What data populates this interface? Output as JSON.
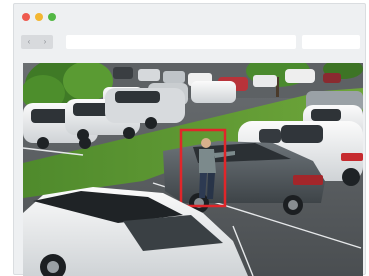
{
  "window": {
    "controls": [
      "close",
      "minimize",
      "zoom"
    ],
    "nav": {
      "back_icon": "chevron-left-icon",
      "forward_icon": "chevron-right-icon",
      "back_glyph": "‹",
      "forward_glyph": "›"
    },
    "address_value": "",
    "search_value": ""
  },
  "colors": {
    "frame": "#eef0f2",
    "close": "#ee5a4f",
    "minimize": "#f3b632",
    "zoom": "#52b744",
    "highlight_box": "#e0262a"
  },
  "content": {
    "image_subject": "camera-view-parking-lot",
    "detection": {
      "label": "",
      "shape": "highlight-box"
    }
  }
}
